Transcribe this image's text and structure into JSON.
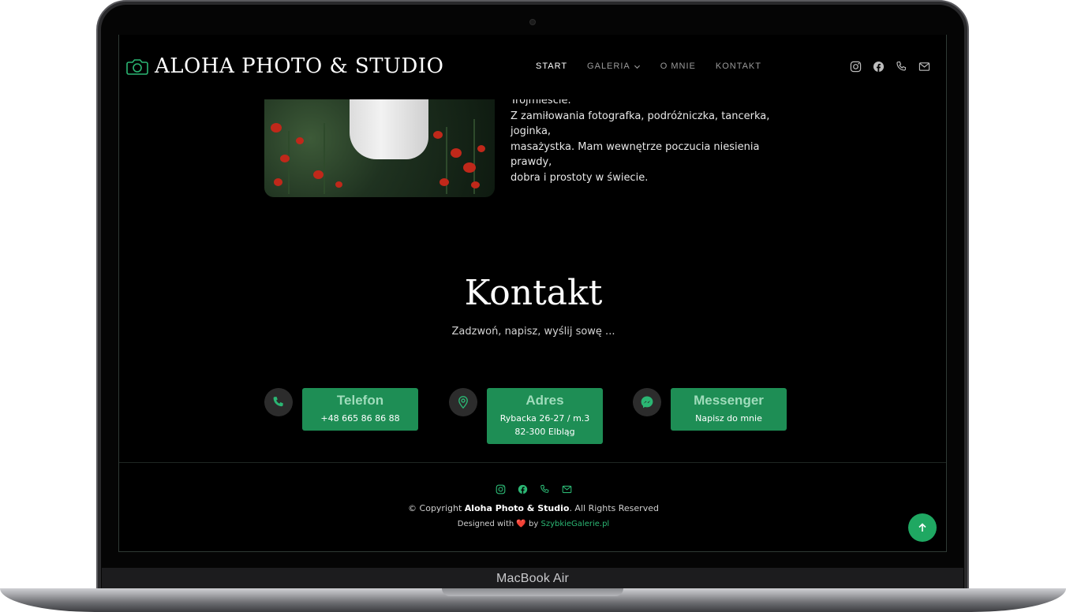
{
  "device": {
    "label": "MacBook Air"
  },
  "header": {
    "brand": "ALOHA PHOTO & STUDIO",
    "nav": [
      {
        "label": "START",
        "active": true
      },
      {
        "label": "GALERIA",
        "dropdown": true
      },
      {
        "label": "O MNIE"
      },
      {
        "label": "KONTAKT"
      }
    ],
    "social_icons": [
      "instagram-icon",
      "facebook-icon",
      "phone-icon",
      "mail-icon"
    ]
  },
  "about": {
    "lines": [
      "Trójmieście.",
      "Z zamiłowania fotografka, podróżniczka, tancerka, joginka,",
      "masażystka. Mam wewnętrze poczucia niesienia prawdy,",
      "dobra i prostoty w świecie."
    ]
  },
  "contact": {
    "title": "Kontakt",
    "subtitle": "Zadzwoń, napisz, wyślij sowę ...",
    "items": [
      {
        "icon": "phone-icon",
        "title": "Telefon",
        "lines": [
          "+48 665 86 86 88"
        ]
      },
      {
        "icon": "map-pin-icon",
        "title": "Adres",
        "lines": [
          "Rybacka 26-27 / m.3",
          "82-300 Elbląg"
        ]
      },
      {
        "icon": "messenger-icon",
        "title": "Messenger",
        "lines": [
          "Napisz do mnie"
        ]
      }
    ]
  },
  "footer": {
    "copyright_prefix": "© Copyright ",
    "copyright_brand": "Aloha Photo & Studio",
    "copyright_suffix": ". All Rights Reserved",
    "designed_prefix": "Designed with ",
    "designed_heart": "❤️",
    "designed_by": " by ",
    "designed_link": "SzybkieGalerie.pl"
  },
  "colors": {
    "accent": "#1e8e55",
    "accent_icon": "#2bb673",
    "background": "#000000"
  }
}
